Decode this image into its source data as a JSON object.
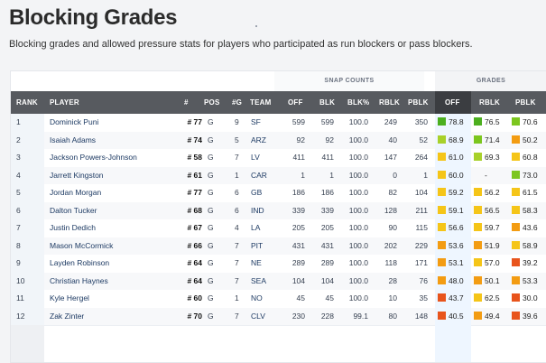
{
  "page": {
    "title": "Blocking Grades",
    "subtitle": "Blocking grades and allowed pressure stats for players who participated as run blockers or pass blockers."
  },
  "table": {
    "group_headers": {
      "snap_counts": "SNAP COUNTS",
      "grades": "GRADES"
    },
    "columns": {
      "rank": "RANK",
      "player": "PLAYER",
      "jersey": "#",
      "pos": "POS",
      "games": "#G",
      "team": "TEAM",
      "off": "OFF",
      "blk": "BLK",
      "blk_pct": "BLK%",
      "rblk": "RBLK",
      "pblk": "PBLK",
      "g_off": "OFF",
      "g_rblk": "RBLK",
      "g_pblk": "PBLK"
    },
    "rows": [
      {
        "rank": "1",
        "player": "Dominick Puni",
        "jersey": "# 77",
        "pos": "G",
        "games": "9",
        "team": "SF",
        "off": "599",
        "blk": "599",
        "blk_pct": "100.0",
        "rblk": "249",
        "pblk": "350",
        "g_off": "78.8",
        "g_rblk": "76.5",
        "g_pblk": "70.6",
        "c_off": "#4caf1f",
        "c_rblk": "#4caf1f",
        "c_pblk": "#7cc61e"
      },
      {
        "rank": "2",
        "player": "Isaiah Adams",
        "jersey": "# 74",
        "pos": "G",
        "games": "5",
        "team": "ARZ",
        "off": "92",
        "blk": "92",
        "blk_pct": "100.0",
        "rblk": "40",
        "pblk": "52",
        "g_off": "68.9",
        "g_rblk": "71.4",
        "g_pblk": "50.2",
        "c_off": "#a8d12a",
        "c_rblk": "#7cc61e",
        "c_pblk": "#f39c12"
      },
      {
        "rank": "3",
        "player": "Jackson Powers-Johnson",
        "jersey": "# 58",
        "pos": "G",
        "games": "7",
        "team": "LV",
        "off": "411",
        "blk": "411",
        "blk_pct": "100.0",
        "rblk": "147",
        "pblk": "264",
        "g_off": "61.0",
        "g_rblk": "69.3",
        "g_pblk": "60.8",
        "c_off": "#f5c518",
        "c_rblk": "#a8d12a",
        "c_pblk": "#f5c518"
      },
      {
        "rank": "4",
        "player": "Jarrett Kingston",
        "jersey": "# 61",
        "pos": "G",
        "games": "1",
        "team": "CAR",
        "off": "1",
        "blk": "1",
        "blk_pct": "100.0",
        "rblk": "0",
        "pblk": "1",
        "g_off": "60.0",
        "g_rblk": "-",
        "g_pblk": "73.0",
        "c_off": "#f5c518",
        "c_rblk": "",
        "c_pblk": "#7cc61e"
      },
      {
        "rank": "5",
        "player": "Jordan Morgan",
        "jersey": "# 77",
        "pos": "G",
        "games": "6",
        "team": "GB",
        "off": "186",
        "blk": "186",
        "blk_pct": "100.0",
        "rblk": "82",
        "pblk": "104",
        "g_off": "59.2",
        "g_rblk": "56.2",
        "g_pblk": "61.5",
        "c_off": "#f5c518",
        "c_rblk": "#f5c518",
        "c_pblk": "#f5c518"
      },
      {
        "rank": "6",
        "player": "Dalton Tucker",
        "jersey": "# 68",
        "pos": "G",
        "games": "6",
        "team": "IND",
        "off": "339",
        "blk": "339",
        "blk_pct": "100.0",
        "rblk": "128",
        "pblk": "211",
        "g_off": "59.1",
        "g_rblk": "56.5",
        "g_pblk": "58.3",
        "c_off": "#f5c518",
        "c_rblk": "#f5c518",
        "c_pblk": "#f5c518"
      },
      {
        "rank": "7",
        "player": "Justin Dedich",
        "jersey": "# 67",
        "pos": "G",
        "games": "4",
        "team": "LA",
        "off": "205",
        "blk": "205",
        "blk_pct": "100.0",
        "rblk": "90",
        "pblk": "115",
        "g_off": "56.6",
        "g_rblk": "59.7",
        "g_pblk": "43.6",
        "c_off": "#f5c518",
        "c_rblk": "#f5c518",
        "c_pblk": "#f39c12"
      },
      {
        "rank": "8",
        "player": "Mason McCormick",
        "jersey": "# 66",
        "pos": "G",
        "games": "7",
        "team": "PIT",
        "off": "431",
        "blk": "431",
        "blk_pct": "100.0",
        "rblk": "202",
        "pblk": "229",
        "g_off": "53.6",
        "g_rblk": "51.9",
        "g_pblk": "58.9",
        "c_off": "#f39c12",
        "c_rblk": "#f39c12",
        "c_pblk": "#f5c518"
      },
      {
        "rank": "9",
        "player": "Layden Robinson",
        "jersey": "# 64",
        "pos": "G",
        "games": "7",
        "team": "NE",
        "off": "289",
        "blk": "289",
        "blk_pct": "100.0",
        "rblk": "118",
        "pblk": "171",
        "g_off": "53.1",
        "g_rblk": "57.0",
        "g_pblk": "39.2",
        "c_off": "#f39c12",
        "c_rblk": "#f5c518",
        "c_pblk": "#e8541c"
      },
      {
        "rank": "10",
        "player": "Christian Haynes",
        "jersey": "# 64",
        "pos": "G",
        "games": "7",
        "team": "SEA",
        "off": "104",
        "blk": "104",
        "blk_pct": "100.0",
        "rblk": "28",
        "pblk": "76",
        "g_off": "48.0",
        "g_rblk": "50.1",
        "g_pblk": "53.3",
        "c_off": "#f39c12",
        "c_rblk": "#f39c12",
        "c_pblk": "#f39c12"
      },
      {
        "rank": "11",
        "player": "Kyle Hergel",
        "jersey": "# 60",
        "pos": "G",
        "games": "1",
        "team": "NO",
        "off": "45",
        "blk": "45",
        "blk_pct": "100.0",
        "rblk": "10",
        "pblk": "35",
        "g_off": "43.7",
        "g_rblk": "62.5",
        "g_pblk": "30.0",
        "c_off": "#e8541c",
        "c_rblk": "#f5c518",
        "c_pblk": "#e8541c"
      },
      {
        "rank": "12",
        "player": "Zak Zinter",
        "jersey": "# 70",
        "pos": "G",
        "games": "7",
        "team": "CLV",
        "off": "230",
        "blk": "228",
        "blk_pct": "99.1",
        "rblk": "80",
        "pblk": "148",
        "g_off": "40.5",
        "g_rblk": "49.4",
        "g_pblk": "39.6",
        "c_off": "#e8541c",
        "c_rblk": "#f39c12",
        "c_pblk": "#e8541c"
      }
    ]
  }
}
